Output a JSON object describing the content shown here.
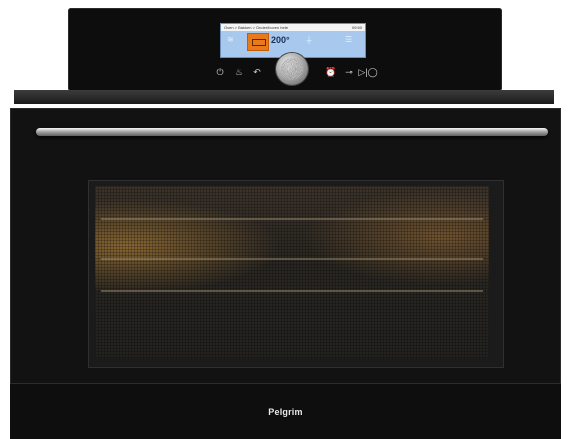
{
  "display": {
    "breadcrumb": "Oven > Bakken > Onder/boven hete",
    "time": "09:50",
    "temperature": "200°"
  },
  "controls": {
    "power_symbol": "⏻",
    "flame_symbol": "♨",
    "back_symbol": "↶",
    "timer_symbol": "⏰",
    "lock_symbol": "⊸",
    "start_symbol": "▷|◯"
  },
  "brand": "Pelgrim",
  "colors": {
    "selection": "#e87a1c",
    "screen": "#a8c8ee",
    "body": "#121212"
  },
  "icons": [
    "power-icon",
    "flame-icon",
    "back-icon",
    "timer-icon",
    "lock-icon",
    "start-stop-icon",
    "menu-icon"
  ]
}
